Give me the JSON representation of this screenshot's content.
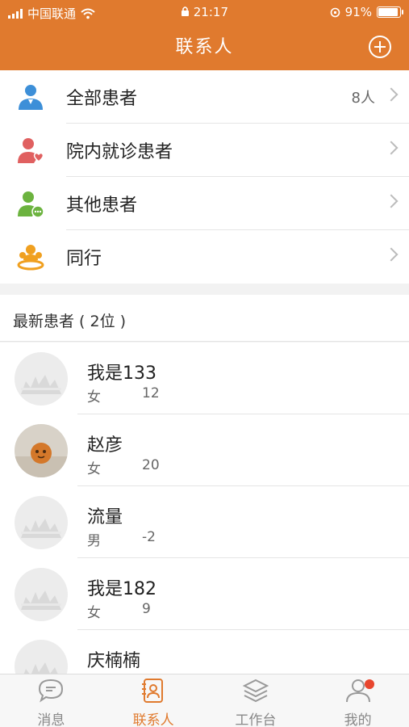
{
  "status_bar": {
    "carrier": "中国联通",
    "time": "21:17",
    "battery": "91%",
    "battery_level": 0.91
  },
  "header": {
    "title": "联系人"
  },
  "menu": [
    {
      "label": "全部患者",
      "count": "8人",
      "icon": "doctor-icon",
      "color": "#3d8fd8"
    },
    {
      "label": "院内就诊患者",
      "count": "",
      "icon": "person-heart-icon",
      "color": "#e06060"
    },
    {
      "label": "其他患者",
      "count": "",
      "icon": "person-more-icon",
      "color": "#6cb33f"
    },
    {
      "label": "同行",
      "count": "",
      "icon": "colleagues-icon",
      "color": "#f0a020"
    }
  ],
  "section": {
    "title": "最新患者 ( 2位 )"
  },
  "patients": [
    {
      "name": "我是133",
      "sex": "女",
      "age": "12",
      "avatar": "default"
    },
    {
      "name": "赵彦",
      "sex": "女",
      "age": "20",
      "avatar": "photo"
    },
    {
      "name": "流量",
      "sex": "男",
      "age": "-2",
      "avatar": "default"
    },
    {
      "name": "我是182",
      "sex": "女",
      "age": "9",
      "avatar": "default"
    },
    {
      "name": "庆楠楠",
      "sex": "",
      "age": "",
      "avatar": "default"
    }
  ],
  "tabs": [
    {
      "label": "消息",
      "icon": "message-icon",
      "active": false
    },
    {
      "label": "联系人",
      "icon": "contacts-icon",
      "active": true
    },
    {
      "label": "工作台",
      "icon": "layers-icon",
      "active": false
    },
    {
      "label": "我的",
      "icon": "profile-icon",
      "active": false
    }
  ],
  "colors": {
    "accent": "#e07a2e",
    "badge": "#e8462e"
  }
}
